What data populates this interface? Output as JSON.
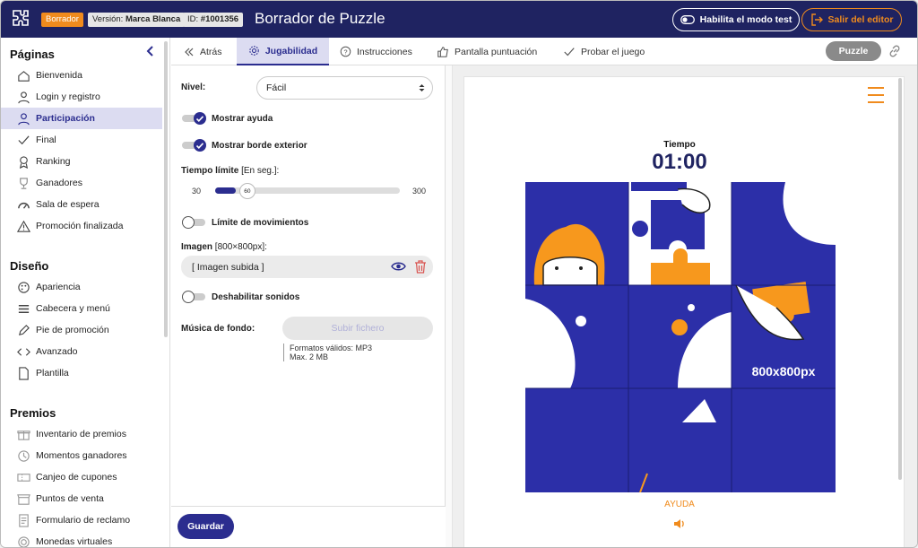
{
  "topbar": {
    "draft_badge": "Borrador",
    "version_prefix": "Versión:",
    "version_value": "Marca Blanca",
    "id_prefix": "ID:",
    "id_value": "#1001356",
    "title": "Borrador de Puzzle",
    "test_mode_label": "Habilita el modo test",
    "exit_label": "Salir del editor",
    "accent": "#f08b1d",
    "bg": "#1f2361"
  },
  "sidebar": {
    "sections": [
      {
        "title": "Páginas",
        "items": [
          {
            "label": "Bienvenida",
            "icon": "home-icon"
          },
          {
            "label": "Login y registro",
            "icon": "user-icon"
          },
          {
            "label": "Participación",
            "icon": "user-icon",
            "active": true
          },
          {
            "label": "Final",
            "icon": "check-icon"
          },
          {
            "label": "Ranking",
            "icon": "medal-icon"
          },
          {
            "label": "Ganadores",
            "icon": "trophy-icon"
          },
          {
            "label": "Sala de espera",
            "icon": "gauge-icon"
          },
          {
            "label": "Promoción finalizada",
            "icon": "warning-icon"
          }
        ]
      },
      {
        "title": "Diseño",
        "items": [
          {
            "label": "Apariencia",
            "icon": "palette-icon"
          },
          {
            "label": "Cabecera y menú",
            "icon": "menu-icon"
          },
          {
            "label": "Pie de promoción",
            "icon": "pen-icon"
          },
          {
            "label": "Avanzado",
            "icon": "code-icon"
          },
          {
            "label": "Plantilla",
            "icon": "file-icon"
          }
        ]
      },
      {
        "title": "Premios",
        "items": [
          {
            "label": "Inventario de premios",
            "icon": "gift-icon"
          },
          {
            "label": "Momentos ganadores",
            "icon": "clock-icon"
          },
          {
            "label": "Canjeo de cupones",
            "icon": "coupon-icon"
          },
          {
            "label": "Puntos de venta",
            "icon": "store-icon"
          },
          {
            "label": "Formulario de reclamo",
            "icon": "form-icon"
          },
          {
            "label": "Monedas virtuales",
            "icon": "coin-icon"
          }
        ]
      }
    ]
  },
  "tabs": {
    "back": "Atrás",
    "gameplay": "Jugabilidad",
    "instructions": "Instrucciones",
    "score_screen": "Pantalla puntuación",
    "try_game": "Probar el juego",
    "game_type": "Puzzle"
  },
  "settings": {
    "level_label": "Nivel:",
    "level_value": "Fácil",
    "show_help_label": "Mostrar ayuda",
    "show_help_on": true,
    "show_border_label": "Mostrar borde exterior",
    "show_border_on": true,
    "time_limit_label": "Tiempo límite",
    "time_limit_unit": "[En seg.]:",
    "time_min": "30",
    "time_max": "300",
    "time_value": "60",
    "moves_limit_label": "Límite de movimientos",
    "moves_limit_on": false,
    "image_label": "Imagen",
    "image_size": "[800×800px]:",
    "image_value": "[ Imagen subida ]",
    "disable_sounds_label": "Deshabilitar sonidos",
    "disable_sounds_on": false,
    "music_label": "Música de fondo:",
    "upload_label": "Subir fichero",
    "formats_hint": "Formatos válidos: MP3",
    "max_hint": "Max. 2 MB",
    "save_label": "Guardar"
  },
  "preview": {
    "time_label": "Tiempo",
    "time_value": "01:00",
    "image_text": "800x800px",
    "help_label": "AYUDA"
  }
}
